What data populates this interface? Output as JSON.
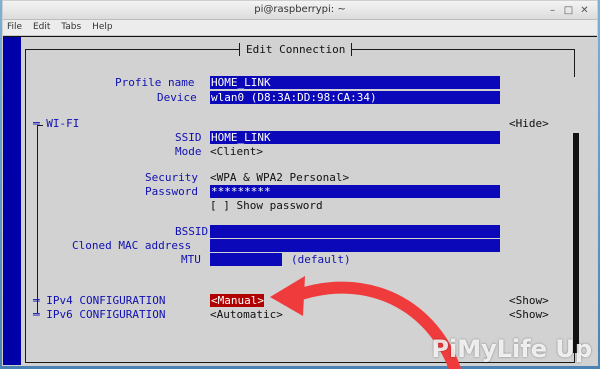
{
  "window": {
    "title": "pi@raspberrypi: ~",
    "menu": [
      "File",
      "Edit",
      "Tabs",
      "Help"
    ],
    "controls": [
      "–",
      "□",
      "✕"
    ]
  },
  "dialog": {
    "title": "Edit Connection",
    "profile_name_label": "Profile name",
    "profile_name_value": "HOME_LINK",
    "device_label": "Device",
    "device_value": "wlan0 (D8:3A:DD:98:CA:34)",
    "wifi_section": "═ WI-FI",
    "wifi_toggle": "<Hide>",
    "ssid_label": "SSID",
    "ssid_value": "HOME_LINK",
    "mode_label": "Mode",
    "mode_value": "<Client>",
    "security_label": "Security",
    "security_value": "<WPA & WPA2 Personal>",
    "password_label": "Password",
    "password_value": "*********",
    "show_password": "[ ] Show password",
    "bssid_label": "BSSID",
    "cloned_mac_label": "Cloned MAC address",
    "mtu_label": "MTU",
    "mtu_default": "(default)",
    "ipv4_label": "═ IPv4 CONFIGURATION",
    "ipv4_value": "<Manual>",
    "ipv4_toggle": "<Show>",
    "ipv6_label": "═ IPv6 CONFIGURATION",
    "ipv6_value": "<Automatic>",
    "ipv6_toggle": "<Show>"
  },
  "watermark": "PiMyLife Up",
  "colors": {
    "terminal_blue": "#0000a8",
    "dialog_gray": "#d2d2d2",
    "field_blue": "#0a08b8",
    "selected_red": "#b00000",
    "arrow_red": "#ef3b3b"
  }
}
